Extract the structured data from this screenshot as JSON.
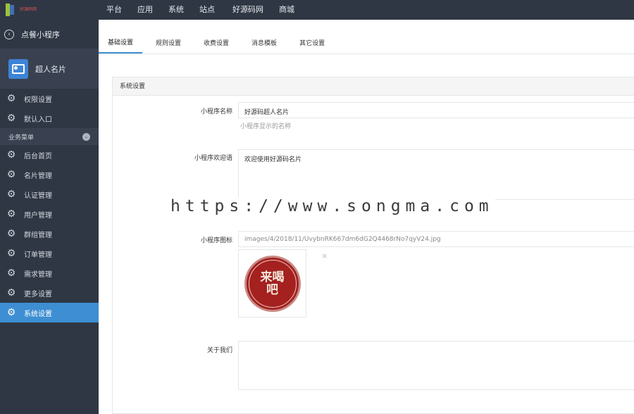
{
  "topbar": {
    "logo_text": "好源码网",
    "nav": [
      "平台",
      "应用",
      "系统",
      "站点",
      "好源码网",
      "商城"
    ]
  },
  "sidebar": {
    "back_label": "点餐小程序",
    "app_name": "超人名片",
    "top_items": [
      "权限设置",
      "默认入口"
    ],
    "section_label": "业务菜单",
    "items": [
      "后台首页",
      "名片管理",
      "认证管理",
      "用户管理",
      "群组管理",
      "订单管理",
      "需求管理",
      "更多设置",
      "系统设置"
    ],
    "active_item": "系统设置"
  },
  "tabs": [
    "基础设置",
    "规则设置",
    "收费设置",
    "消息模板",
    "其它设置"
  ],
  "active_tab": "基础设置",
  "panel": {
    "title": "系统设置",
    "fields": {
      "name": {
        "label": "小程序名称",
        "value": "好源码超人名片",
        "help": "小程序显示的名称"
      },
      "welcome": {
        "label": "小程序欢迎语",
        "value": "欢迎使用好源码名片"
      },
      "icon": {
        "label": "小程序图标",
        "value": "images/4/2018/11/UvybnRK667dm6dG2Q4468rNo7qyV24.jpg",
        "seal_text": "来喝吧",
        "remove_symbol": "×"
      },
      "about": {
        "label": "关于我们",
        "value": ""
      }
    }
  },
  "watermark": "https://www.songma.com"
}
